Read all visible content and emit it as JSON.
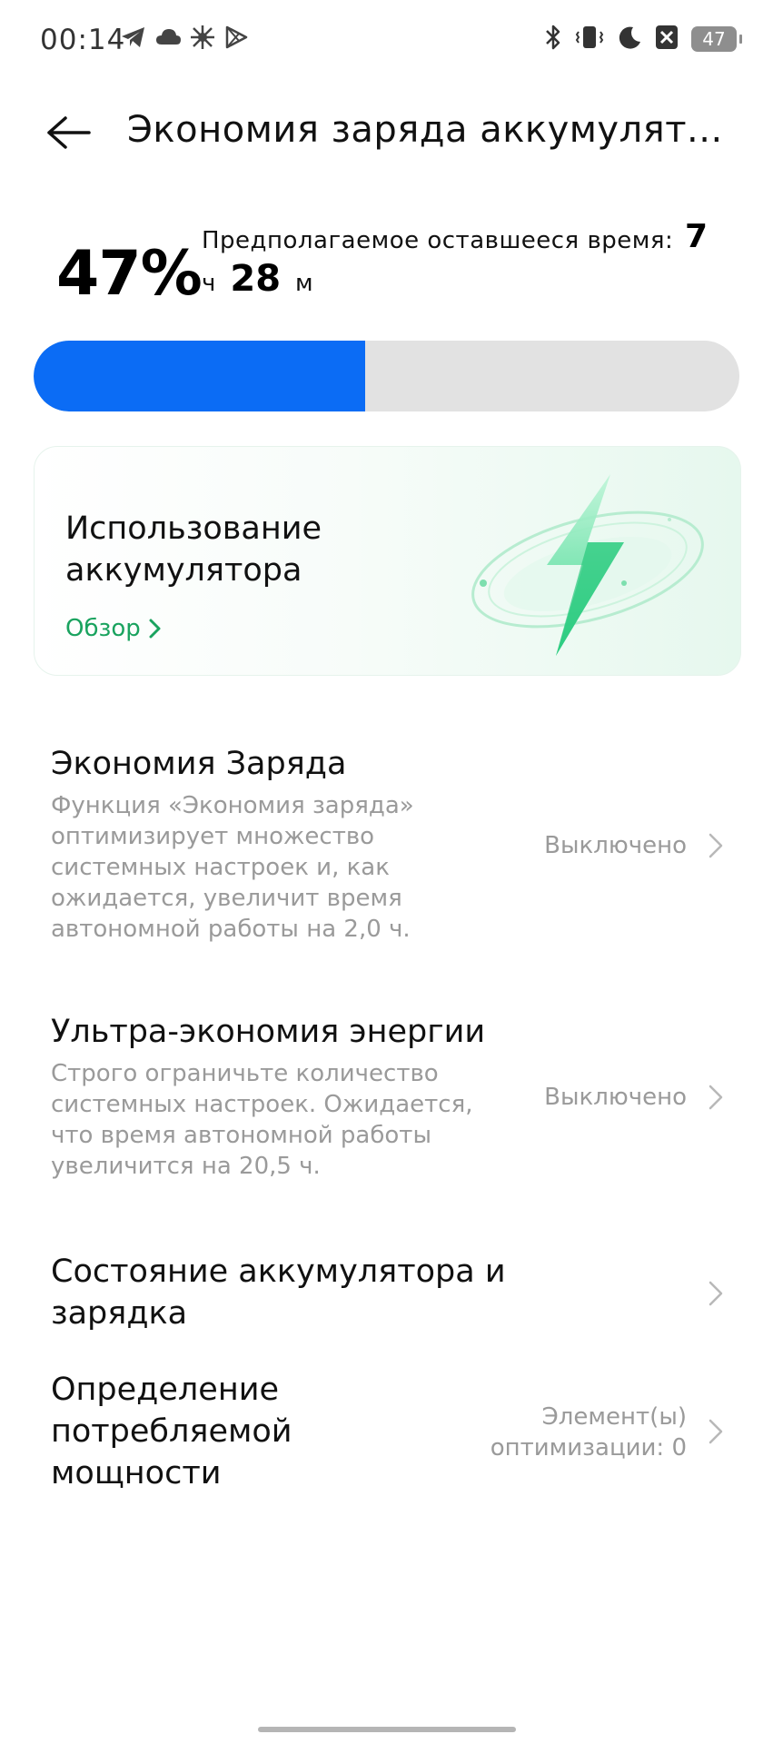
{
  "status_bar": {
    "time": "00:14",
    "battery_level": "47",
    "left_icons": [
      "telegram-icon",
      "cloud-icon",
      "sparkle-icon",
      "play-store-icon"
    ],
    "right_icons": [
      "bluetooth-icon",
      "vibrate-icon",
      "moon-icon",
      "no-sim-icon",
      "battery-icon"
    ]
  },
  "header": {
    "title": "Экономия заряда аккумулят..."
  },
  "battery": {
    "percent_text": "47%",
    "percent_value": 47,
    "remaining_label": "Предполагаемое оставшееся время:",
    "hours": "7",
    "hours_unit": "ч",
    "minutes": "28",
    "minutes_unit": "м",
    "bar_color": "#0b6cf5"
  },
  "usage_card": {
    "title": "Использование аккумулятора",
    "link_label": "Обзор",
    "accent": "#1aa35f"
  },
  "settings": [
    {
      "title": "Экономия Заряда",
      "description": "Функция «Экономия заряда» оптимизирует множество системных настроек и, как ожидается, увеличит время автономной работы на 2,0 ч.",
      "value": "Выключено"
    },
    {
      "title": "Ультра-экономия энергии",
      "description": "Строго ограничьте количество системных настроек. Ожидается, что время автономной работы увеличится на 20,5 ч.",
      "value": "Выключено"
    },
    {
      "title": "Состояние аккумулятора и зарядка",
      "description": "",
      "value": ""
    },
    {
      "title": "Определение потребляемой мощности",
      "description": "",
      "value": "Элемент(ы) оптимизации: 0"
    }
  ]
}
